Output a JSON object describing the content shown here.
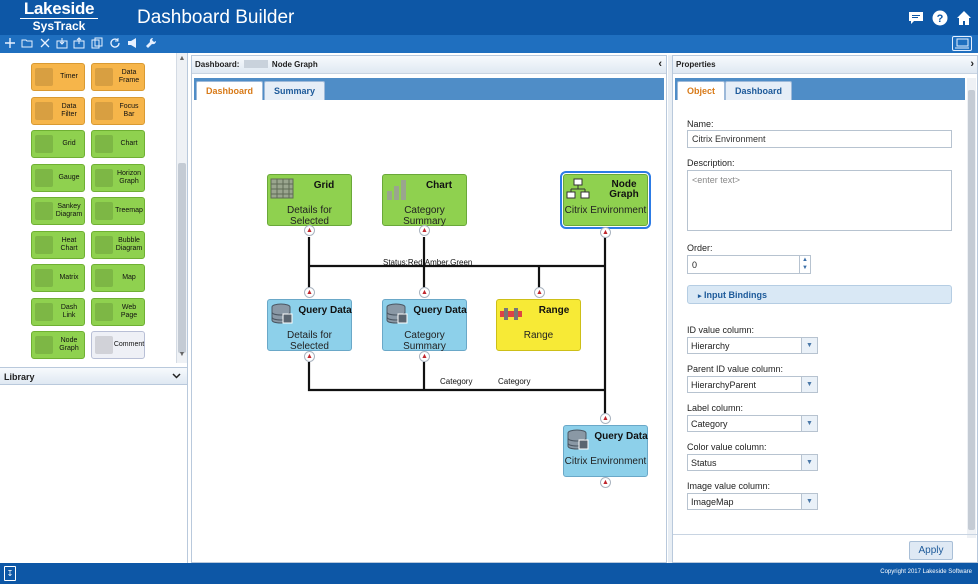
{
  "header": {
    "logo_line1": "Lakeside",
    "logo_line2": "SysTrack",
    "title": "Dashboard Builder",
    "icons": [
      "chat-icon",
      "help-icon",
      "home-icon"
    ]
  },
  "toolbar": {
    "icons": [
      "add-icon",
      "open-folder-icon",
      "close-icon",
      "import-icon",
      "export-icon",
      "copy-icon",
      "refresh-icon",
      "announce-icon",
      "wrench-icon"
    ],
    "right_icon": "presentation-icon"
  },
  "palette": {
    "items": [
      {
        "label": "Timer",
        "color": "orange",
        "icon": "hourglass-icon"
      },
      {
        "label": "Data Frame",
        "color": "orange",
        "icon": "crop-icon"
      },
      {
        "label": "Data Filter",
        "color": "orange",
        "icon": "filter-icon"
      },
      {
        "label": "Focus Bar",
        "color": "orange",
        "icon": "focus-icon"
      },
      {
        "label": "Grid",
        "color": "green",
        "icon": "grid-icon"
      },
      {
        "label": "Chart",
        "color": "green",
        "icon": "bar-chart-icon"
      },
      {
        "label": "Gauge",
        "color": "green",
        "icon": "gauge-icon"
      },
      {
        "label": "Horizon Graph",
        "color": "green",
        "icon": "horizon-icon"
      },
      {
        "label": "Sankey Diagram",
        "color": "green",
        "icon": "sankey-icon"
      },
      {
        "label": "Treemap",
        "color": "green",
        "icon": "treemap-icon"
      },
      {
        "label": "Heat Chart",
        "color": "green",
        "icon": "heat-icon"
      },
      {
        "label": "Bubble Diagram",
        "color": "green",
        "icon": "bubble-icon"
      },
      {
        "label": "Matrix",
        "color": "green",
        "icon": "matrix-icon"
      },
      {
        "label": "Map",
        "color": "green",
        "icon": "globe-icon"
      },
      {
        "label": "Dash Link",
        "color": "green",
        "icon": "link-icon"
      },
      {
        "label": "Web Page",
        "color": "green",
        "icon": "web-icon"
      },
      {
        "label": "Node Graph",
        "color": "green",
        "icon": "node-graph-icon"
      },
      {
        "label": "Comment",
        "color": "white",
        "icon": "comment-icon"
      }
    ]
  },
  "library": {
    "title": "Library"
  },
  "center": {
    "header_prefix": "Dashboard:",
    "header_name": "Node Graph",
    "tabs": [
      {
        "label": "Dashboard",
        "active": true
      },
      {
        "label": "Summary",
        "active": false
      }
    ]
  },
  "graph": {
    "nodes": [
      {
        "id": "grid",
        "title": "Grid",
        "subtitle": "Details for Selected",
        "color": "green",
        "icon": "grid-icon"
      },
      {
        "id": "chart",
        "title": "Chart",
        "subtitle": "Category Summary",
        "color": "green",
        "icon": "bar-chart-icon"
      },
      {
        "id": "nodegraph",
        "title": "Node Graph",
        "subtitle": "Citrix Environment",
        "color": "green",
        "icon": "node-graph-icon",
        "selected": true
      },
      {
        "id": "qd1",
        "title": "Query Data",
        "subtitle": "Details for Selected",
        "color": "blue",
        "icon": "database-icon"
      },
      {
        "id": "qd2",
        "title": "Query Data",
        "subtitle": "Category Summary",
        "color": "blue",
        "icon": "database-icon"
      },
      {
        "id": "range",
        "title": "Range",
        "subtitle": "Range",
        "color": "yellow",
        "icon": "range-icon"
      },
      {
        "id": "qd3",
        "title": "Query Data",
        "subtitle": "Citrix Environment",
        "color": "blue",
        "icon": "database-icon"
      }
    ],
    "edge_labels": {
      "top": "Status:Red,Amber,Green",
      "bottom1": "Category",
      "bottom2": "Category"
    }
  },
  "properties": {
    "header": "Properties",
    "tabs": [
      {
        "label": "Object",
        "active": true
      },
      {
        "label": "Dashboard",
        "active": false
      }
    ],
    "name_label": "Name:",
    "name_value": "Citrix Environment",
    "description_label": "Description:",
    "description_placeholder": "<enter text>",
    "order_label": "Order:",
    "order_value": "0",
    "input_bindings": "Input Bindings",
    "id_label": "ID value column:",
    "id_value": "Hierarchy",
    "parent_label": "Parent ID value column:",
    "parent_value": "HierarchyParent",
    "label_label": "Label column:",
    "label_value": "Category",
    "color_label": "Color value column:",
    "color_value": "Status",
    "image_label": "Image value column:",
    "image_value": "ImageMap",
    "apply": "Apply"
  },
  "footer": {
    "copyright": "Copyright 2017 Lakeside Software"
  },
  "colors": {
    "brand_blue": "#0d57a6",
    "node_green": "#8fd14f",
    "node_blue": "#8dd0ea",
    "node_yellow": "#f7ea36",
    "palette_orange": "#f6b54a",
    "tab_active_text": "#d87a18",
    "port_arrow": "#c0262d"
  }
}
